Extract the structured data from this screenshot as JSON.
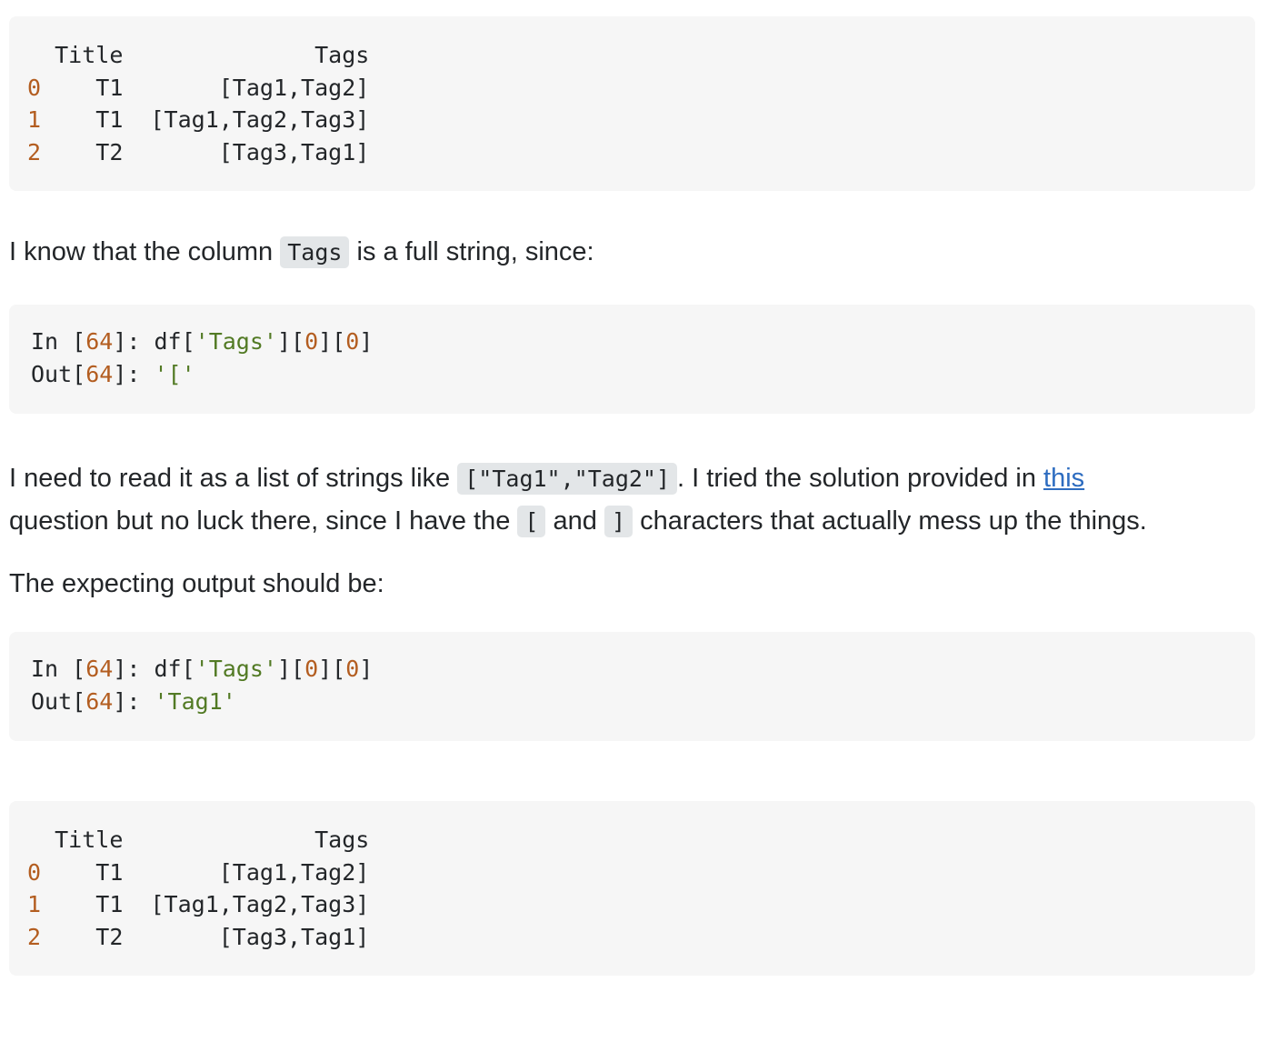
{
  "code_block_1": {
    "header_title": "Title",
    "header_tags": "Tags",
    "rows": [
      {
        "index": "0",
        "title": "T1",
        "tags": "[Tag1,Tag2]"
      },
      {
        "index": "1",
        "title": "T1",
        "tags": "[Tag1,Tag2,Tag3]"
      },
      {
        "index": "2",
        "title": "T2",
        "tags": "[Tag3,Tag1]"
      }
    ]
  },
  "paragraph_1": {
    "before": "I know that the column ",
    "code": "Tags",
    "after": " is a full string, since:"
  },
  "code_block_2": {
    "in_prefix": "In [",
    "in_number": "64",
    "in_mid": "]: df[",
    "in_string": "'Tags'",
    "in_mid2": "][",
    "in_index1": "0",
    "in_mid3": "][",
    "in_index2": "0",
    "in_end": "]",
    "out_prefix": "Out[",
    "out_number": "64",
    "out_mid": "]: ",
    "out_string": "'['"
  },
  "paragraph_2": {
    "part1": "I need to read it as a list of strings like ",
    "code1": "[\"Tag1\",\"Tag2\"]",
    "part2": ". I tried the solution provided in ",
    "link": "this",
    "part3": " question but no luck there, since I have the ",
    "code2": "[",
    "part4": " and ",
    "code3": "]",
    "part5": " characters that actually mess up the things."
  },
  "paragraph_3": {
    "text": "The expecting output should be:"
  },
  "code_block_3": {
    "in_prefix": "In [",
    "in_number": "64",
    "in_mid": "]: df[",
    "in_string": "'Tags'",
    "in_mid2": "][",
    "in_index1": "0",
    "in_mid3": "][",
    "in_index2": "0",
    "in_end": "]",
    "out_prefix": "Out[",
    "out_number": "64",
    "out_mid": "]: ",
    "out_string": "'Tag1'"
  },
  "code_block_4": {
    "header_title": "Title",
    "header_tags": "Tags",
    "rows": [
      {
        "index": "0",
        "title": "T1",
        "tags": "[Tag1,Tag2]"
      },
      {
        "index": "1",
        "title": "T1",
        "tags": "[Tag1,Tag2,Tag3]"
      },
      {
        "index": "2",
        "title": "T2",
        "tags": "[Tag3,Tag1]"
      }
    ]
  },
  "colors": {
    "code_background": "#f6f6f6",
    "inline_code_background": "#e3e6e8",
    "number_color": "#b35d20",
    "string_color": "#527a24",
    "link_color": "#2d6cc0",
    "text_color": "#232629"
  }
}
